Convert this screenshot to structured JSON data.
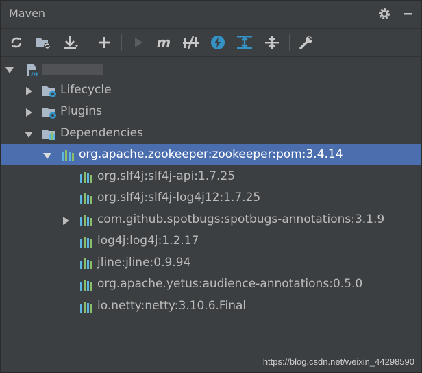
{
  "panel": {
    "title": "Maven"
  },
  "header_icons": [
    "gear-icon",
    "minimize-icon"
  ],
  "toolbar": [
    "reload-icon",
    "add-project-icon",
    "download-icon",
    "add-icon",
    "run-icon",
    "execute-goal-icon",
    "toggle-offline-icon",
    "skip-tests-icon",
    "show-dependencies-icon",
    "collapse-all-icon",
    "settings-icon"
  ],
  "tree": {
    "root": {
      "label": "",
      "expanded": true
    },
    "lifecycle": {
      "label": "Lifecycle"
    },
    "plugins": {
      "label": "Plugins"
    },
    "dependencies": {
      "label": "Dependencies"
    },
    "dep_items": [
      "org.apache.zookeeper:zookeeper:pom:3.4.14",
      "org.slf4j:slf4j-api:1.7.25",
      "org.slf4j:slf4j-log4j12:1.7.25",
      "com.github.spotbugs:spotbugs-annotations:3.1.9",
      "log4j:log4j:1.2.17",
      "jline:jline:0.9.94",
      "org.apache.yetus:audience-annotations:0.5.0",
      "io.netty:netty:3.10.6.Final"
    ]
  },
  "watermark": "https://blog.csdn.net/weixin_44298590",
  "colors": {
    "background": "#3c3f41",
    "selection": "#4b6eaf",
    "text": "#bbbbbb",
    "lib_icon_blue": "#5eb7e0",
    "lib_icon_green": "#8bbf6a"
  }
}
